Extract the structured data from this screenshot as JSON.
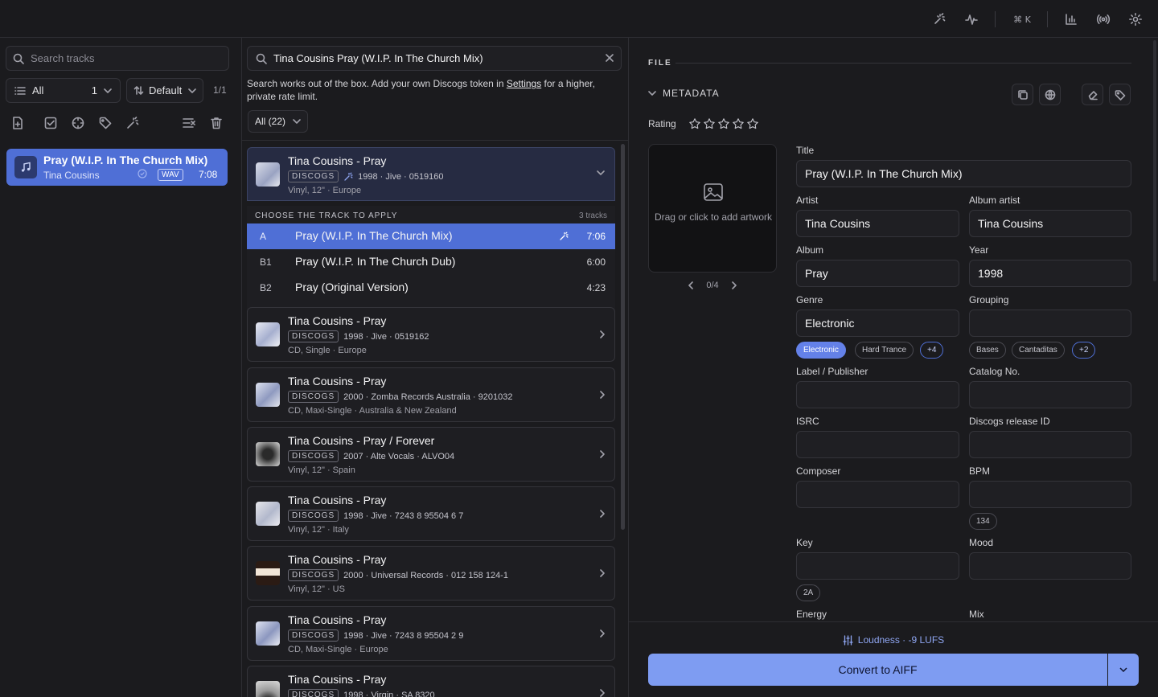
{
  "topbar": {
    "shortcut": "⌘ K"
  },
  "library": {
    "search_placeholder": "Search tracks",
    "filter": {
      "label": "All",
      "count": "1"
    },
    "sort": "Default",
    "page": "1/1",
    "tracks": [
      {
        "title": "Pray (W.I.P. In The Church Mix)",
        "artist": "Tina Cousins",
        "format": "WAV",
        "duration": "7:08"
      }
    ]
  },
  "lookup": {
    "query": "Tina Cousins Pray (W.I.P. In The Church Mix)",
    "note_pre": "Search works out of the box. Add your own Discogs token in ",
    "note_link": "Settings",
    "note_post": " for a higher, private rate limit.",
    "results_filter": "All (22)",
    "source_badge": "DISCOGS",
    "choose_header": "CHOOSE THE TRACK TO APPLY",
    "choose_count": "3 tracks",
    "expanded": {
      "title": "Tina Cousins - Pray",
      "meta": "1998 · Jive · 0519160",
      "sub": "Vinyl, 12\" · Europe"
    },
    "tracklist": [
      {
        "pos": "A",
        "name": "Pray (W.I.P. In The Church Mix)",
        "dur": "7:06"
      },
      {
        "pos": "B1",
        "name": "Pray (W.I.P. In The Church Dub)",
        "dur": "6:00"
      },
      {
        "pos": "B2",
        "name": "Pray (Original Version)",
        "dur": "4:23"
      }
    ],
    "results": [
      {
        "title": "Tina Cousins - Pray",
        "meta": "1998 · Jive · 0519162",
        "sub": "CD, Single · Europe"
      },
      {
        "title": "Tina Cousins - Pray",
        "meta": "2000 · Zomba Records Australia · 9201032",
        "sub": "CD, Maxi-Single · Australia & New Zealand"
      },
      {
        "title": "Tina Cousins - Pray / Forever",
        "meta": "2007 · Alte Vocals · ALVO04",
        "sub": "Vinyl, 12\" · Spain"
      },
      {
        "title": "Tina Cousins - Pray",
        "meta": "1998 · Jive · 7243 8 95504 6 7",
        "sub": "Vinyl, 12\" · Italy"
      },
      {
        "title": "Tina Cousins - Pray",
        "meta": "2000 · Universal Records · 012 158 124-1",
        "sub": "Vinyl, 12\" · US"
      },
      {
        "title": "Tina Cousins - Pray",
        "meta": "1998 · Jive · 7243 8 95504 2 9",
        "sub": "CD, Maxi-Single · Europe"
      },
      {
        "title": "Tina Cousins - Pray",
        "meta": "1998 · Virgin · SA 8320",
        "sub": ""
      }
    ]
  },
  "editor": {
    "file_header": "FILE",
    "metadata_header": "METADATA",
    "rating_label": "Rating",
    "rating": 0,
    "artwork_text": "Drag or click to add artwork",
    "artwork_pager": "0/4",
    "fields": {
      "title": {
        "label": "Title",
        "value": "Pray (W.I.P. In The Church Mix)"
      },
      "artist": {
        "label": "Artist",
        "value": "Tina Cousins"
      },
      "album_artist": {
        "label": "Album artist",
        "value": "Tina Cousins"
      },
      "album": {
        "label": "Album",
        "value": "Pray"
      },
      "year": {
        "label": "Year",
        "value": "1998"
      },
      "genre": {
        "label": "Genre",
        "value": "Electronic"
      },
      "grouping": {
        "label": "Grouping",
        "value": ""
      },
      "label": {
        "label": "Label / Publisher",
        "value": ""
      },
      "catalog": {
        "label": "Catalog No.",
        "value": ""
      },
      "isrc": {
        "label": "ISRC",
        "value": ""
      },
      "discogs_id": {
        "label": "Discogs release ID",
        "value": ""
      },
      "composer": {
        "label": "Composer",
        "value": ""
      },
      "bpm": {
        "label": "BPM",
        "value": ""
      },
      "key": {
        "label": "Key",
        "value": ""
      },
      "mood": {
        "label": "Mood",
        "value": ""
      },
      "energy": {
        "label": "Energy"
      },
      "mix": {
        "label": "Mix"
      }
    },
    "genre_chips": [
      "Electronic",
      "Hard Trance",
      "+4"
    ],
    "grouping_chips": [
      "Bases",
      "Cantaditas",
      "+2"
    ],
    "bpm_chip": "134",
    "key_chip": "2A",
    "loudness": "Loudness · -9 LUFS",
    "convert_label": "Convert to AIFF"
  },
  "colors": {
    "accent": "#4f6fd6",
    "button": "#7e9cf2",
    "background": "#1b1b1e"
  }
}
